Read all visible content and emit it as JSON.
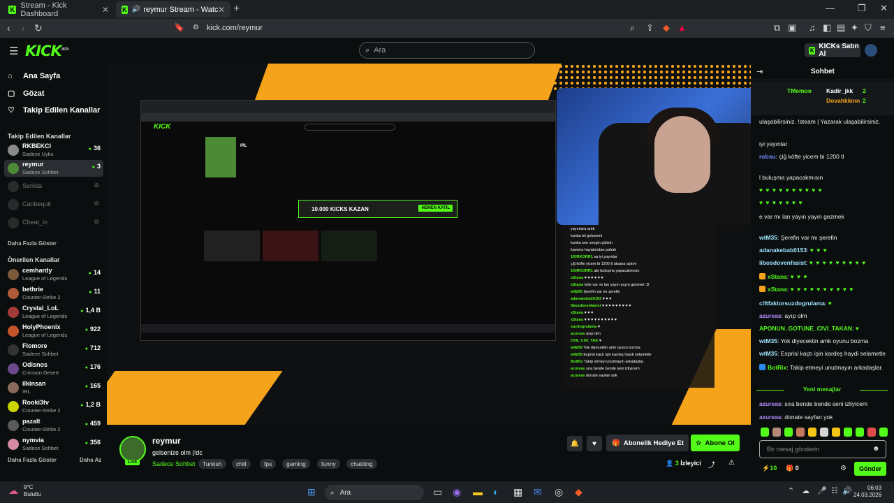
{
  "browser": {
    "tabs": [
      {
        "label": "Stream - Kick Dashboard"
      },
      {
        "label": "reymur Stream - Watch Live o"
      }
    ],
    "url": "kick.com/reymur"
  },
  "header": {
    "logo": "KICK",
    "logo_sup": "BETA",
    "search_placeholder": "Ara",
    "kicks_button": "KICKs Satın Al"
  },
  "sidebar": {
    "nav": [
      {
        "label": "Ana Sayfa",
        "icon": "home-icon"
      },
      {
        "label": "Gözat",
        "icon": "browse-icon"
      },
      {
        "label": "Takip Edilen Kanallar",
        "icon": "heart-icon"
      }
    ],
    "followed_title": "Takip Edilen Kanallar",
    "followed": [
      {
        "name": "RKBEKCI",
        "sub": "Sadece Uyku",
        "viewers": "36",
        "color": "#8a8a8a"
      },
      {
        "name": "reymur",
        "sub": "Sadece Sohbet",
        "viewers": "3",
        "color": "#4d8a36"
      },
      {
        "name": "Seriida",
        "sub": "",
        "viewers": "",
        "color": "#555"
      },
      {
        "name": "Canbequit",
        "sub": "",
        "viewers": "",
        "color": "#555"
      },
      {
        "name": "Cheat_in",
        "sub": "",
        "viewers": "",
        "color": "#555"
      }
    ],
    "show_more_followed": "Daha Fazla Göster",
    "recommended_title": "Önerilen Kanallar",
    "recommended": [
      {
        "name": "cemhardy",
        "sub": "League of Legends",
        "viewers": "14",
        "color": "#7a5a3a"
      },
      {
        "name": "bethrie",
        "sub": "Counter-Strike 2",
        "viewers": "11",
        "color": "#b05a3a"
      },
      {
        "name": "Crystal_LoL",
        "sub": "League of Legends",
        "viewers": "1,4 B",
        "color": "#a33a3a"
      },
      {
        "name": "HolyPhoenix",
        "sub": "League of Legends",
        "viewers": "922",
        "color": "#c4552a"
      },
      {
        "name": "Flomore",
        "sub": "Sadece Sohbet",
        "viewers": "712",
        "color": "#333"
      },
      {
        "name": "Odisnos",
        "sub": "Crimson Desert",
        "viewers": "176",
        "color": "#6a4a8a"
      },
      {
        "name": "ilkinsan",
        "sub": "IRL",
        "viewers": "165",
        "color": "#8a6a5a"
      },
      {
        "name": "Rooki3tv",
        "sub": "Counter-Strike 2",
        "viewers": "1,2 B",
        "color": "#c9d400"
      },
      {
        "name": "pazalt",
        "sub": "Counter-Strike 2",
        "viewers": "459",
        "color": "#5a5a5a"
      },
      {
        "name": "nymvia",
        "sub": "Sadece Sohbet",
        "viewers": "356",
        "color": "#d48aa0"
      }
    ],
    "show_more_recommended": "Daha Fazla Göster",
    "show_less": "Daha Az"
  },
  "stream": {
    "channel": "reymur",
    "live": "LIVE",
    "title": "gelsenize olm |!dc",
    "category": "Sadece Sohbet",
    "tags": [
      "Turkish",
      "chill",
      "fps",
      "gaming",
      "funny",
      "chatiting"
    ],
    "gift_button": "Abonelik Hediye Et",
    "subscribe_button": "Abone Ol",
    "viewers": "3",
    "viewers_label": "İzleyici"
  },
  "video_inner": {
    "logo": "KICK",
    "category": "IRL",
    "kicks_banner": "10.000 KICKS KAZAN",
    "join": "HEMEN KATIL",
    "overlay_chat": [
      {
        "u": "",
        "t": "yayınlara artık"
      },
      {
        "u": "",
        "t": "kanka iel gelcenmi"
      },
      {
        "u": "",
        "t": "kanka sen zengin gibisin"
      },
      {
        "u": "",
        "t": "kamera hayatımdan pahalı"
      },
      {
        "u": "1KIRKORR1",
        "t": "sa iyi yayınlar"
      },
      {
        "u": "",
        "t": "çiğ köfte yicem bi 1200 tl atsana aşkım"
      },
      {
        "u": "1KIRKORR1",
        "t": "abi buluşma yapacakmısın"
      },
      {
        "u": "xStana",
        "t": "♥ ♥ ♥ ♥ ♥ ♥"
      },
      {
        "u": "xStana",
        "t": "öyle var mı lan yayın yayın gezmek :D"
      },
      {
        "u": "wtM35",
        "t": "Şerefin var mı şerefin"
      },
      {
        "u": "adanakebab0153",
        "t": "♥ ♥ ♥"
      },
      {
        "u": "libosdovenfasist",
        "t": "♥ ♥ ♥ ♥ ♥ ♥ ♥ ♥ ♥"
      },
      {
        "u": "xStana",
        "t": "♥ ♥ ♥"
      },
      {
        "u": "xStana",
        "t": "♥ ♥ ♥ ♥ ♥ ♥ ♥ ♥ ♥ ♥"
      },
      {
        "u": "suzdogrulama",
        "t": "♥"
      },
      {
        "u": "azureas",
        "t": "ayıp olm"
      },
      {
        "u": "OVE_CIVI_TAK",
        "t": "♥"
      },
      {
        "u": "wtM35",
        "t": "Yok diyecektin amk oyunu bozma"
      },
      {
        "u": "wtM35",
        "t": "Esprisi kaçtı işin kardeş haydi selametle"
      },
      {
        "u": "BotRix",
        "t": "Takip etmeyi unutmayın arkadaşlar."
      },
      {
        "u": "azureas",
        "t": "sıra bende bende seni izliyicem"
      },
      {
        "u": "azureas",
        "t": "donate sayfan yok"
      }
    ]
  },
  "chat": {
    "title": "Sohbet",
    "pinned": [
      {
        "u": "TMemoo",
        "c": "#53fc18"
      },
      {
        "u": "Kadir_jkk",
        "c": "#ffffff",
        "n": "2"
      },
      {
        "u": "Dovahkkinn",
        "c": "#f5a31a",
        "n": "2"
      }
    ],
    "messages": [
      {
        "u": "",
        "c": "#ffffff",
        "t": "ulaşabilirsiniz. !steam | Yazarak ulaşabilirsiniz."
      },
      {
        "u": "",
        "c": "#ffffff",
        "t": "iyi yayınlar"
      },
      {
        "u": "robsu",
        "c": "#6c8cff",
        "t": "çiğ köfte yicem bi 1200 tl"
      },
      {
        "u": "",
        "c": "#ffffff",
        "t": "l buluşma yapacakmısın"
      },
      {
        "u": "",
        "c": "#53fc18",
        "t": "♥ ♥ ♥ ♥ ♥ ♥ ♥ ♥ ♥ ♥"
      },
      {
        "u": "",
        "c": "#53fc18",
        "t": "♥ ♥ ♥ ♥ ♥ ♥ ♥"
      },
      {
        "u": "",
        "c": "#ffffff",
        "t": "e var mı lan yayın yayın gezmek"
      },
      {
        "u": "wtM35",
        "c": "#9fe5ff",
        "t": "Şerefin var mı şerefin"
      },
      {
        "u": "adanakebab0153",
        "c": "#9fe5ff",
        "t": "♥ ♥ ♥"
      },
      {
        "u": "libosdovenfasist",
        "c": "#9fe5ff",
        "t": "♥ ♥ ♥ ♥ ♥ ♥ ♥ ♥ ♥"
      },
      {
        "u": "xStana",
        "c": "#53fc18",
        "t": "♥ ♥ ♥"
      },
      {
        "u": "xStana",
        "c": "#53fc18",
        "t": "♥ ♥ ♥ ♥ ♥ ♥ ♥ ♥ ♥ ♥"
      },
      {
        "u": "ciftfaktorsuzdogrulama",
        "c": "#9fe5ff",
        "t": "♥"
      },
      {
        "u": "azureas",
        "c": "#b58cff",
        "t": "ayıp olm"
      },
      {
        "u": "APONUN_GOTUNE_CIVI_TAKAN",
        "c": "#53fc18",
        "t": "♥"
      },
      {
        "u": "wtM35",
        "c": "#9fe5ff",
        "t": "Yok diyecektin amk oyunu bozma"
      },
      {
        "u": "wtM35",
        "c": "#9fe5ff",
        "t": "Esprisi kaçtı işin kardeş haydi selametle"
      },
      {
        "u": "BotRix",
        "c": "#53fc18",
        "t": "Takip etmeyi unutmayın arkadaşlar."
      }
    ],
    "new_messages": "Yeni mesajlar",
    "new": [
      {
        "u": "azureas",
        "c": "#b58cff",
        "t": "sıra bende bende seni izliyicem"
      },
      {
        "u": "azureas",
        "c": "#b58cff",
        "t": "donate sayfan yok"
      }
    ],
    "input_placeholder": "Bir mesaj gönderin",
    "kicks": "10",
    "gifts": "0",
    "send": "Gönder"
  },
  "taskbar": {
    "temp": "9°C",
    "weather": "Bulutlu",
    "search": "Ara",
    "time": "06:03",
    "date": "24.03.2026"
  }
}
